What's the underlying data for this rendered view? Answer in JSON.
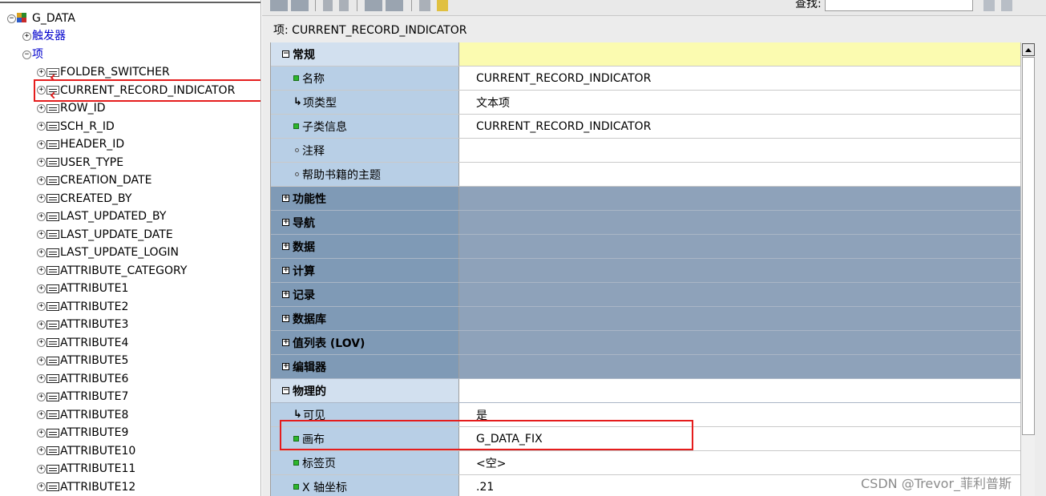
{
  "tree": {
    "root": "G_DATA",
    "triggers": "触发器",
    "items_group": "项",
    "items": [
      "FOLDER_SWITCHER",
      "CURRENT_RECORD_INDICATOR",
      "ROW_ID",
      "SCH_R_ID",
      "HEADER_ID",
      "USER_TYPE",
      "CREATION_DATE",
      "CREATED_BY",
      "LAST_UPDATED_BY",
      "LAST_UPDATE_DATE",
      "LAST_UPDATE_LOGIN",
      "ATTRIBUTE_CATEGORY",
      "ATTRIBUTE1",
      "ATTRIBUTE2",
      "ATTRIBUTE3",
      "ATTRIBUTE4",
      "ATTRIBUTE5",
      "ATTRIBUTE6",
      "ATTRIBUTE7",
      "ATTRIBUTE8",
      "ATTRIBUTE9",
      "ATTRIBUTE10",
      "ATTRIBUTE11",
      "ATTRIBUTE12"
    ],
    "selected_item": "CURRENT_RECORD_INDICATOR"
  },
  "toolbar": {
    "find_label": "查找:",
    "find_value": ""
  },
  "palette": {
    "title": "项: CURRENT_RECORD_INDICATOR",
    "rows": [
      {
        "kind": "head",
        "key": "常规",
        "value": ""
      },
      {
        "kind": "prop",
        "marker": "dot",
        "key": "名称",
        "value": "CURRENT_RECORD_INDICATOR"
      },
      {
        "kind": "prop",
        "marker": "hook",
        "key": "项类型",
        "value": "文本项"
      },
      {
        "kind": "prop",
        "marker": "dot",
        "key": "子类信息",
        "value": "CURRENT_RECORD_INDICATOR"
      },
      {
        "kind": "prop",
        "marker": "hollow",
        "key": "注释",
        "value": ""
      },
      {
        "kind": "prop",
        "marker": "hollow",
        "key": "帮助书籍的主题",
        "value": ""
      },
      {
        "kind": "cat",
        "key": "功能性",
        "value": ""
      },
      {
        "kind": "cat",
        "key": "导航",
        "value": ""
      },
      {
        "kind": "cat",
        "key": "数据",
        "value": ""
      },
      {
        "kind": "cat",
        "key": "计算",
        "value": ""
      },
      {
        "kind": "cat",
        "key": "记录",
        "value": ""
      },
      {
        "kind": "cat",
        "key": "数据库",
        "value": ""
      },
      {
        "kind": "cat",
        "key": "值列表 (LOV)",
        "value": ""
      },
      {
        "kind": "cat",
        "key": "编辑器",
        "value": ""
      },
      {
        "kind": "open",
        "key": "物理的",
        "value": ""
      },
      {
        "kind": "prop",
        "marker": "hook",
        "key": "可见",
        "value": "是"
      },
      {
        "kind": "prop",
        "marker": "dot",
        "key": "画布",
        "value": "G_DATA_FIX"
      },
      {
        "kind": "prop",
        "marker": "dot",
        "key": "标签页",
        "value": "<空>"
      },
      {
        "kind": "prop",
        "marker": "dot",
        "key": "X 轴坐标",
        "value": ".21"
      }
    ]
  },
  "watermark": "CSDN @Trevor_菲利普斯",
  "colors": {
    "category_bg": "#8ea2ba",
    "property_key_bg": "#b8cfe6",
    "header_value_bg": "#fbfbb0",
    "highlight": "#e51d1d"
  }
}
